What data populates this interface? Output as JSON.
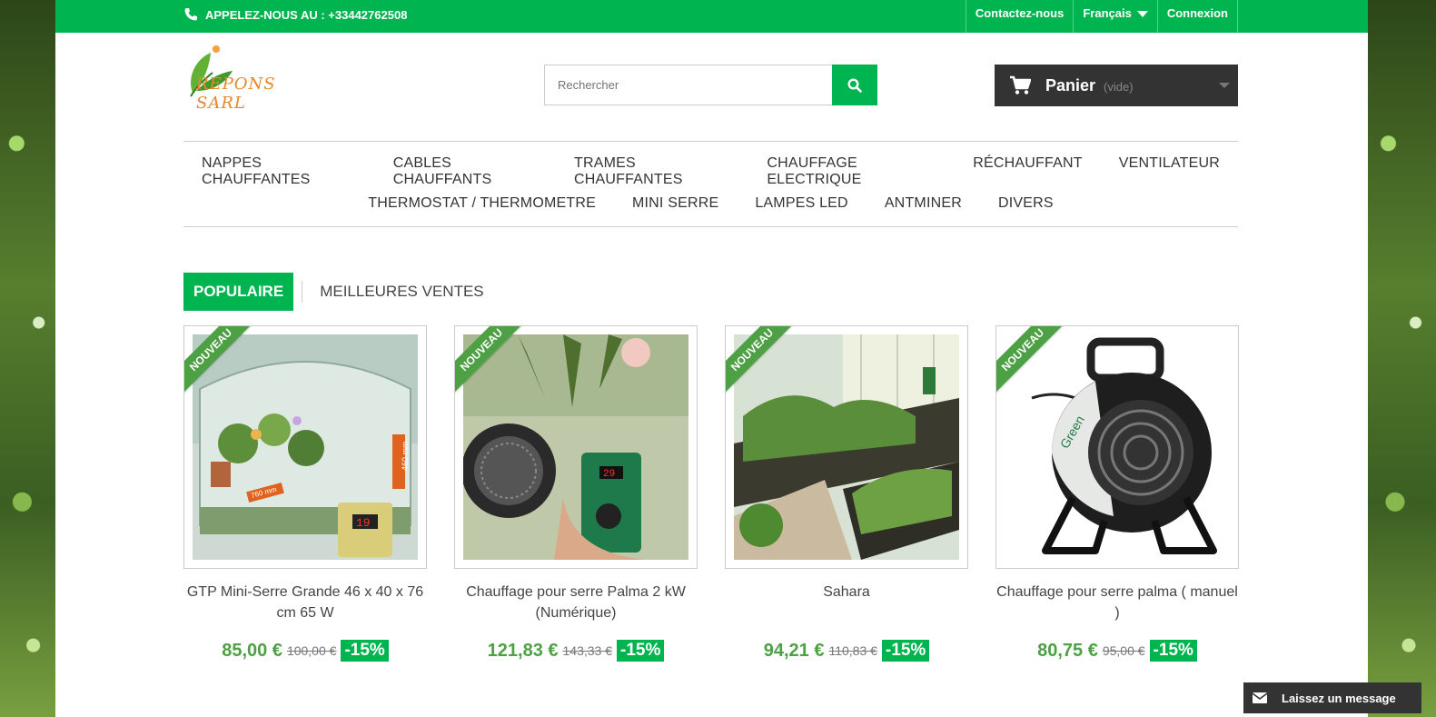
{
  "topbar": {
    "phone": "APPELEZ-NOUS AU : +33442762508",
    "links": [
      "Contactez-nous",
      "Français",
      "Connexion"
    ]
  },
  "header": {
    "logo_text": "REPONS SARL",
    "search_placeholder": "Rechercher",
    "cart_label": "Panier",
    "cart_status": "(vide)"
  },
  "nav": {
    "row1": [
      "NAPPES CHAUFFANTES",
      "CABLES CHAUFFANTS",
      "TRAMES CHAUFFANTES",
      "CHAUFFAGE ELECTRIQUE",
      "RÉCHAUFFANT",
      "VENTILATEUR"
    ],
    "row2": [
      "THERMOSTAT / THERMOMETRE",
      "MINI SERRE",
      "LAMPES LED",
      "ANTMINER",
      "DIVERS"
    ]
  },
  "tabs": {
    "active": "POPULAIRE",
    "other": "MEILLEURES VENTES"
  },
  "products": [
    {
      "badge": "NOUVEAU",
      "name": "GTP Mini-Serre Grande 46 x 40 x 76 cm 65 W",
      "price": "85,00 €",
      "old_price": "100,00 €",
      "discount": "-15%",
      "img_labels": [
        "760 mm",
        "460 mm",
        "19"
      ]
    },
    {
      "badge": "NOUVEAU",
      "name": "Chauffage pour serre Palma 2 kW (Numérique)",
      "price": "121,83 €",
      "old_price": "143,33 €",
      "discount": "-15%",
      "img_labels": [
        "29"
      ]
    },
    {
      "badge": "NOUVEAU",
      "name": "Sahara",
      "price": "94,21 €",
      "old_price": "110,83 €",
      "discount": "-15%",
      "img_labels": []
    },
    {
      "badge": "NOUVEAU",
      "name": "Chauffage pour serre palma ( manuel )",
      "price": "80,75 €",
      "old_price": "95,00 €",
      "discount": "-15%",
      "img_labels": [
        "Green"
      ]
    }
  ],
  "chat": {
    "label": "Laissez un message"
  },
  "colors": {
    "brand_green": "#00b550",
    "price_green": "#4da044",
    "dark": "#333333"
  }
}
